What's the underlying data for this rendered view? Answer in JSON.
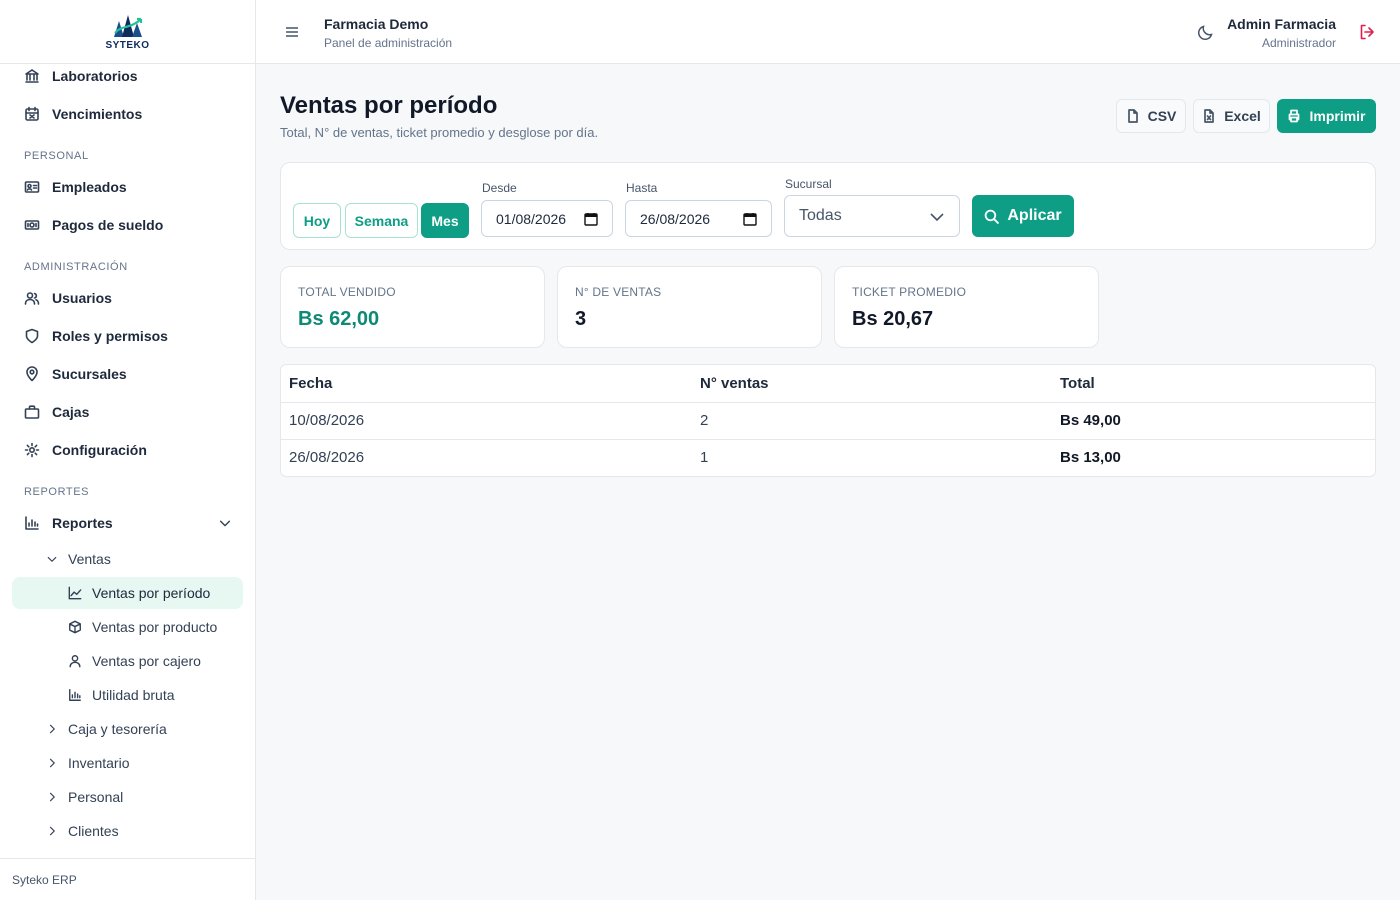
{
  "brand": {
    "logo_text": "SYTEKO",
    "footer": "Syteko ERP"
  },
  "sidebar": {
    "top_items": [
      {
        "label": "Laboratorios",
        "icon": "bank-icon"
      },
      {
        "label": "Vencimientos",
        "icon": "calendar-x-icon"
      }
    ],
    "sections": [
      {
        "title": "PERSONAL",
        "items": [
          {
            "label": "Empleados",
            "icon": "id-card-icon"
          },
          {
            "label": "Pagos de sueldo",
            "icon": "cash-icon"
          }
        ]
      },
      {
        "title": "ADMINISTRACIÓN",
        "items": [
          {
            "label": "Usuarios",
            "icon": "users-icon"
          },
          {
            "label": "Roles y permisos",
            "icon": "shield-icon"
          },
          {
            "label": "Sucursales",
            "icon": "map-pin-icon"
          },
          {
            "label": "Cajas",
            "icon": "briefcase-icon"
          },
          {
            "label": "Configuración",
            "icon": "gear-icon"
          }
        ]
      },
      {
        "title": "REPORTES",
        "items": [
          {
            "label": "Reportes",
            "icon": "bar-chart-icon"
          }
        ]
      }
    ],
    "reportes_group": {
      "ventas_label": "Ventas",
      "ventas_items": [
        {
          "label": "Ventas por período",
          "icon": "trend-icon",
          "active": true
        },
        {
          "label": "Ventas por producto",
          "icon": "box-icon"
        },
        {
          "label": "Ventas por cajero",
          "icon": "user-icon"
        },
        {
          "label": "Utilidad bruta",
          "icon": "bar-chart-icon"
        }
      ],
      "collapsed": [
        "Caja y tesorería",
        "Inventario",
        "Personal",
        "Clientes"
      ]
    }
  },
  "header": {
    "org_name": "Farmacia Demo",
    "org_subtitle": "Panel de administración",
    "user_name": "Admin Farmacia",
    "user_role": "Administrador"
  },
  "page": {
    "title": "Ventas por período",
    "subtitle": "Total, N° de ventas, ticket promedio y desglose por día.",
    "actions": {
      "csv": "CSV",
      "excel": "Excel",
      "print": "Imprimir"
    }
  },
  "filters": {
    "quick": [
      "Hoy",
      "Semana",
      "Mes"
    ],
    "quick_active": "Mes",
    "desde_label": "Desde",
    "desde_value": "01/08/2026",
    "hasta_label": "Hasta",
    "hasta_value": "26/08/2026",
    "sucursal_label": "Sucursal",
    "sucursal_value": "Todas",
    "apply_label": "Aplicar"
  },
  "stats": [
    {
      "label": "TOTAL VENDIDO",
      "value": "Bs 62,00"
    },
    {
      "label": "N° DE VENTAS",
      "value": "3"
    },
    {
      "label": "TICKET PROMEDIO",
      "value": "Bs 20,67"
    }
  ],
  "table": {
    "columns": [
      "Fecha",
      "N° ventas",
      "Total"
    ],
    "rows": [
      [
        "10/08/2026",
        "2",
        "Bs 49,00"
      ],
      [
        "26/08/2026",
        "1",
        "Bs 13,00"
      ]
    ]
  },
  "colors": {
    "accent": "#0d9e85",
    "danger": "#e11d48"
  }
}
